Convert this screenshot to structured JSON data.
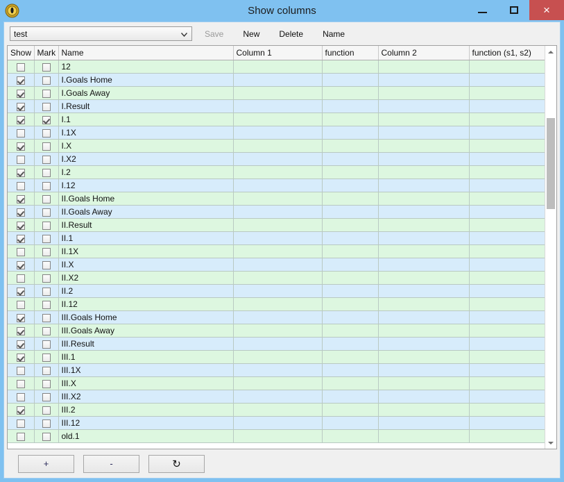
{
  "window": {
    "title": "Show columns",
    "icon": "coin-icon",
    "controls": {
      "minimize": "minimize-icon",
      "maximize": "maximize-icon",
      "close": "×"
    },
    "colors": {
      "titlebar": "#7fc1f0",
      "close_button": "#c75050",
      "row_even": "#ddf7e0",
      "row_odd": "#d7ecfb",
      "client": "#f0f0f0"
    }
  },
  "toolbar": {
    "preset_select": {
      "value": "test",
      "arrow": "⌄"
    },
    "buttons": [
      {
        "label": "Save",
        "disabled": true
      },
      {
        "label": "New",
        "disabled": false
      },
      {
        "label": "Delete",
        "disabled": false
      },
      {
        "label": "Name",
        "disabled": false
      }
    ]
  },
  "grid": {
    "columns": [
      {
        "key": "show",
        "label": "Show"
      },
      {
        "key": "mark",
        "label": "Mark"
      },
      {
        "key": "name",
        "label": "Name"
      },
      {
        "key": "column1",
        "label": "Column 1"
      },
      {
        "key": "function",
        "label": "function"
      },
      {
        "key": "column2",
        "label": "Column 2"
      },
      {
        "key": "function_s1_s2",
        "label": "function (s1, s2)"
      }
    ],
    "rows": [
      {
        "show": false,
        "mark": false,
        "name": "12",
        "column1": "",
        "function": "",
        "column2": "",
        "function_s1_s2": ""
      },
      {
        "show": true,
        "mark": false,
        "name": "I.Goals Home",
        "column1": "",
        "function": "",
        "column2": "",
        "function_s1_s2": ""
      },
      {
        "show": true,
        "mark": false,
        "name": "I.Goals Away",
        "column1": "",
        "function": "",
        "column2": "",
        "function_s1_s2": ""
      },
      {
        "show": true,
        "mark": false,
        "name": "I.Result",
        "column1": "",
        "function": "",
        "column2": "",
        "function_s1_s2": ""
      },
      {
        "show": true,
        "mark": true,
        "name": "I.1",
        "column1": "",
        "function": "",
        "column2": "",
        "function_s1_s2": ""
      },
      {
        "show": false,
        "mark": false,
        "name": "I.1X",
        "column1": "",
        "function": "",
        "column2": "",
        "function_s1_s2": ""
      },
      {
        "show": true,
        "mark": false,
        "name": "I.X",
        "column1": "",
        "function": "",
        "column2": "",
        "function_s1_s2": ""
      },
      {
        "show": false,
        "mark": false,
        "name": "I.X2",
        "column1": "",
        "function": "",
        "column2": "",
        "function_s1_s2": ""
      },
      {
        "show": true,
        "mark": false,
        "name": "I.2",
        "column1": "",
        "function": "",
        "column2": "",
        "function_s1_s2": ""
      },
      {
        "show": false,
        "mark": false,
        "name": "I.12",
        "column1": "",
        "function": "",
        "column2": "",
        "function_s1_s2": ""
      },
      {
        "show": true,
        "mark": false,
        "name": "II.Goals Home",
        "column1": "",
        "function": "",
        "column2": "",
        "function_s1_s2": ""
      },
      {
        "show": true,
        "mark": false,
        "name": "II.Goals Away",
        "column1": "",
        "function": "",
        "column2": "",
        "function_s1_s2": ""
      },
      {
        "show": true,
        "mark": false,
        "name": "II.Result",
        "column1": "",
        "function": "",
        "column2": "",
        "function_s1_s2": ""
      },
      {
        "show": true,
        "mark": false,
        "name": "II.1",
        "column1": "",
        "function": "",
        "column2": "",
        "function_s1_s2": ""
      },
      {
        "show": false,
        "mark": false,
        "name": "II.1X",
        "column1": "",
        "function": "",
        "column2": "",
        "function_s1_s2": ""
      },
      {
        "show": true,
        "mark": false,
        "name": "II.X",
        "column1": "",
        "function": "",
        "column2": "",
        "function_s1_s2": ""
      },
      {
        "show": false,
        "mark": false,
        "name": "II.X2",
        "column1": "",
        "function": "",
        "column2": "",
        "function_s1_s2": ""
      },
      {
        "show": true,
        "mark": false,
        "name": "II.2",
        "column1": "",
        "function": "",
        "column2": "",
        "function_s1_s2": ""
      },
      {
        "show": false,
        "mark": false,
        "name": "II.12",
        "column1": "",
        "function": "",
        "column2": "",
        "function_s1_s2": ""
      },
      {
        "show": true,
        "mark": false,
        "name": "III.Goals Home",
        "column1": "",
        "function": "",
        "column2": "",
        "function_s1_s2": ""
      },
      {
        "show": true,
        "mark": false,
        "name": "III.Goals Away",
        "column1": "",
        "function": "",
        "column2": "",
        "function_s1_s2": ""
      },
      {
        "show": true,
        "mark": false,
        "name": "III.Result",
        "column1": "",
        "function": "",
        "column2": "",
        "function_s1_s2": ""
      },
      {
        "show": true,
        "mark": false,
        "name": "III.1",
        "column1": "",
        "function": "",
        "column2": "",
        "function_s1_s2": ""
      },
      {
        "show": false,
        "mark": false,
        "name": "III.1X",
        "column1": "",
        "function": "",
        "column2": "",
        "function_s1_s2": ""
      },
      {
        "show": false,
        "mark": false,
        "name": "III.X",
        "column1": "",
        "function": "",
        "column2": "",
        "function_s1_s2": ""
      },
      {
        "show": false,
        "mark": false,
        "name": "III.X2",
        "column1": "",
        "function": "",
        "column2": "",
        "function_s1_s2": ""
      },
      {
        "show": true,
        "mark": false,
        "name": "III.2",
        "column1": "",
        "function": "",
        "column2": "",
        "function_s1_s2": ""
      },
      {
        "show": false,
        "mark": false,
        "name": "III.12",
        "column1": "",
        "function": "",
        "column2": "",
        "function_s1_s2": ""
      },
      {
        "show": false,
        "mark": false,
        "name": "old.1",
        "column1": "",
        "function": "",
        "column2": "",
        "function_s1_s2": ""
      }
    ],
    "scrollbar": {
      "up_arrow": "scroll-up-icon",
      "down_arrow": "scroll-down-icon",
      "thumb_top_pct": 16,
      "thumb_height_pct": 24
    }
  },
  "bottombar": {
    "buttons": [
      {
        "label": "+",
        "name": "add-row-button"
      },
      {
        "label": "-",
        "name": "remove-row-button"
      },
      {
        "label": "↻",
        "name": "refresh-button"
      }
    ]
  }
}
